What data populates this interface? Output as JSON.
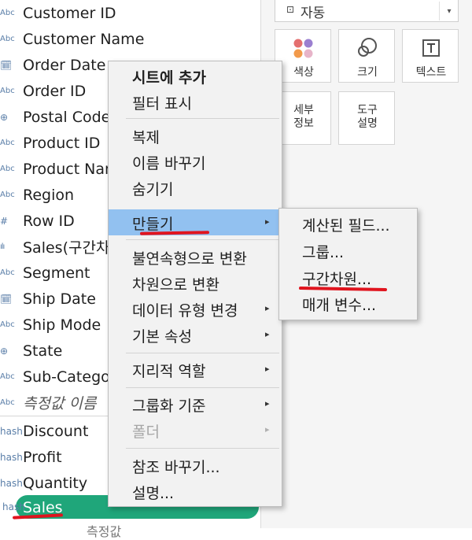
{
  "fields": [
    {
      "type": "Abc",
      "name": "Customer ID",
      "italic": false
    },
    {
      "type": "cal",
      "name": "Customer Name",
      "italic": false
    },
    {
      "type": "cal",
      "name": "Order Date",
      "italic": false
    },
    {
      "type": "Abc",
      "name": "Order ID",
      "italic": false
    },
    {
      "type": "globe",
      "name": "Postal Code",
      "italic": false
    },
    {
      "type": "Abc",
      "name": "Product ID",
      "italic": false
    },
    {
      "type": "Abc",
      "name": "Product Name",
      "italic": false
    },
    {
      "type": "Abc",
      "name": "Region",
      "italic": false
    },
    {
      "type": "hash",
      "name": "Row ID",
      "italic": false
    },
    {
      "type": "bars",
      "name": "Sales(구간차원)",
      "italic": false
    },
    {
      "type": "Abc",
      "name": "Segment",
      "italic": false
    },
    {
      "type": "cal",
      "name": "Ship Date",
      "italic": false
    },
    {
      "type": "Abc",
      "name": "Ship Mode",
      "italic": false
    },
    {
      "type": "globe",
      "name": "State",
      "italic": false
    },
    {
      "type": "Abc",
      "name": "Sub-Category",
      "italic": false
    },
    {
      "type": "Abc",
      "name": "측정값 이름",
      "italic": true
    }
  ],
  "measures": [
    {
      "type": "hash",
      "name": "Discount"
    },
    {
      "type": "hash",
      "name": "Profit"
    },
    {
      "type": "hash",
      "name": "Quantity"
    }
  ],
  "selected_field": {
    "type": "hash",
    "name": "Sales"
  },
  "partial_field_below": "측정값",
  "type_icons": {
    "Abc": "Abc",
    "cal": "🗓",
    "globe": "⊕",
    "hash": "#",
    "bars": "ılı"
  },
  "marks": {
    "mark_type_icon": "⊡",
    "mark_type": "자동",
    "dropdown_caret": "▾",
    "buttons": [
      {
        "name": "color",
        "icon": "color-dots-icon",
        "label": "색상"
      },
      {
        "name": "size",
        "icon": "size-circles-icon",
        "label": "크기"
      },
      {
        "name": "text",
        "icon": "text-T-icon",
        "label": "텍스트"
      },
      {
        "name": "detail",
        "icon": "",
        "label": "세부\n정보"
      },
      {
        "name": "tooltip",
        "icon": "",
        "label": "도구\n설명"
      }
    ]
  },
  "context_menu": {
    "items": [
      {
        "label": "시트에 추가",
        "bold": true
      },
      {
        "label": "필터 표시"
      },
      {
        "label": "복제"
      },
      {
        "label": "이름 바꾸기"
      },
      {
        "label": "숨기기"
      },
      {
        "label": "만들기",
        "submenu": true,
        "highlighted": true
      },
      {
        "label": "불연속형으로 변환"
      },
      {
        "label": "차원으로 변환"
      },
      {
        "label": "데이터 유형 변경",
        "submenu": true
      },
      {
        "label": "기본 속성",
        "submenu": true
      },
      {
        "label": "지리적 역할",
        "submenu": true
      },
      {
        "label": "그룹화 기준",
        "submenu": true
      },
      {
        "label": "폴더",
        "submenu": true,
        "disabled": true
      },
      {
        "label": "참조 바꾸기..."
      },
      {
        "label": "설명..."
      }
    ],
    "arrow": "▸"
  },
  "submenu": {
    "items": [
      {
        "label": "계산된 필드..."
      },
      {
        "label": "그룹..."
      },
      {
        "label": "구간차원..."
      },
      {
        "label": "매개 변수..."
      }
    ]
  },
  "colors": {
    "selected_pill": "#1fa67a",
    "menu_highlight": "#92c1f0",
    "annotation_red": "#e0141e"
  }
}
